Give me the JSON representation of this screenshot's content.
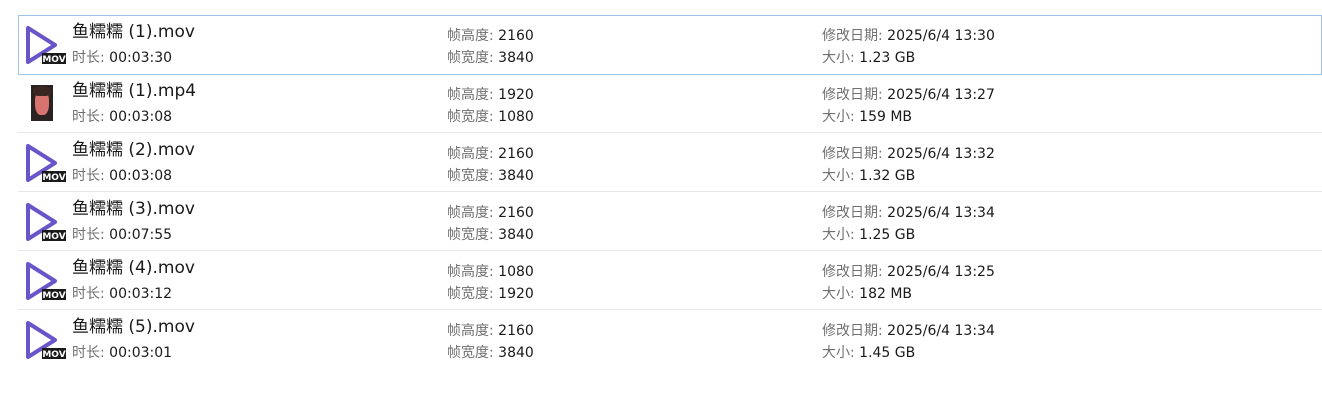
{
  "labels": {
    "duration": "时长:",
    "height": "帧高度:",
    "width": "帧宽度:",
    "modified": "修改日期:",
    "size": "大小:"
  },
  "badge_text": "MOV",
  "colors": {
    "play_icon": "#6a55c8",
    "badge_bg": "#1a1a1a",
    "selection_border": "#9ec3e6"
  },
  "files": [
    {
      "name": "鱼糯糯 (1).mov",
      "duration": "00:03:30",
      "height": "2160",
      "width": "3840",
      "modified": "2025/6/4 13:30",
      "size": "1.23 GB",
      "thumb": "play-icon",
      "selected": true
    },
    {
      "name": "鱼糯糯 (1).mp4",
      "duration": "00:03:08",
      "height": "1920",
      "width": "1080",
      "modified": "2025/6/4 13:27",
      "size": "159 MB",
      "thumb": "photo",
      "selected": false
    },
    {
      "name": "鱼糯糯 (2).mov",
      "duration": "00:03:08",
      "height": "2160",
      "width": "3840",
      "modified": "2025/6/4 13:32",
      "size": "1.32 GB",
      "thumb": "play-icon",
      "selected": false
    },
    {
      "name": "鱼糯糯 (3).mov",
      "duration": "00:07:55",
      "height": "2160",
      "width": "3840",
      "modified": "2025/6/4 13:34",
      "size": "1.25 GB",
      "thumb": "play-icon",
      "selected": false
    },
    {
      "name": "鱼糯糯 (4).mov",
      "duration": "00:03:12",
      "height": "1080",
      "width": "1920",
      "modified": "2025/6/4 13:25",
      "size": "182 MB",
      "thumb": "play-icon",
      "selected": false
    },
    {
      "name": "鱼糯糯 (5).mov",
      "duration": "00:03:01",
      "height": "2160",
      "width": "3840",
      "modified": "2025/6/4 13:34",
      "size": "1.45 GB",
      "thumb": "play-icon",
      "selected": false
    }
  ]
}
